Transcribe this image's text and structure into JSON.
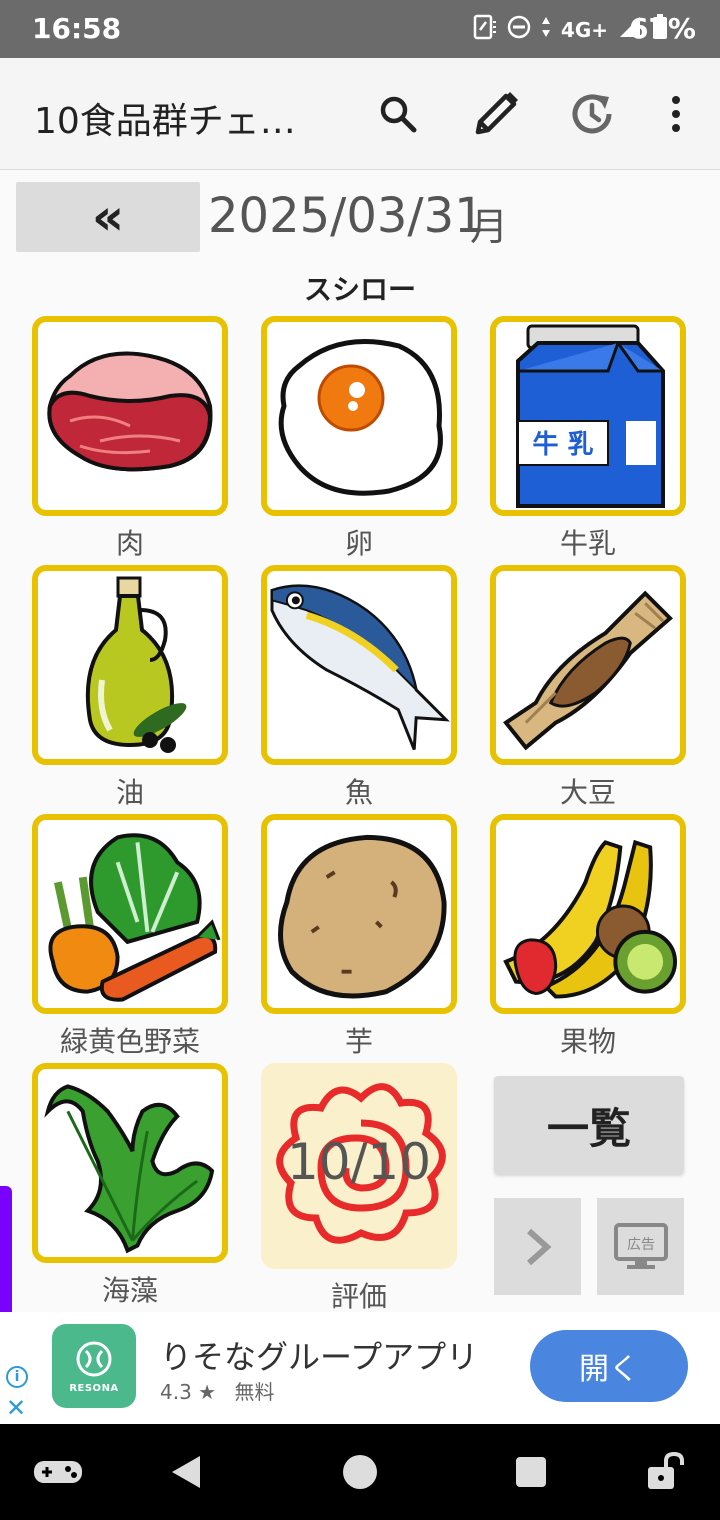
{
  "status": {
    "time": "16:58",
    "network": "4G+",
    "battery": "67%"
  },
  "app": {
    "title": "10食品群チェ…"
  },
  "date": {
    "back_label": "«",
    "date": "2025/03/31",
    "day_of_week": "月"
  },
  "place": "スシロー",
  "foods": [
    {
      "label": "肉",
      "icon": "meat-icon"
    },
    {
      "label": "卵",
      "icon": "egg-icon"
    },
    {
      "label": "牛乳",
      "icon": "milk-icon",
      "carton_text": "牛 乳"
    },
    {
      "label": "油",
      "icon": "oil-icon"
    },
    {
      "label": "魚",
      "icon": "fish-icon"
    },
    {
      "label": "大豆",
      "icon": "soybean-icon"
    },
    {
      "label": "緑黄色野菜",
      "icon": "vegetables-icon"
    },
    {
      "label": "芋",
      "icon": "potato-icon"
    },
    {
      "label": "果物",
      "icon": "fruit-icon"
    },
    {
      "label": "海藻",
      "icon": "seaweed-icon"
    }
  ],
  "evaluation": {
    "label": "評価",
    "score": "10/10"
  },
  "buttons": {
    "list": "一覧",
    "next": "›",
    "ad_label": "広告"
  },
  "ad": {
    "logo_text": "RESONA",
    "title": "りそなグループアプリ",
    "rating": "4.3 ★",
    "price": "無料",
    "open": "開く"
  },
  "colors": {
    "tile_border": "#e8c200",
    "eval_bg": "#faf1cc",
    "ad_button": "#4a85e0",
    "accent_bar": "#7a00ff"
  }
}
